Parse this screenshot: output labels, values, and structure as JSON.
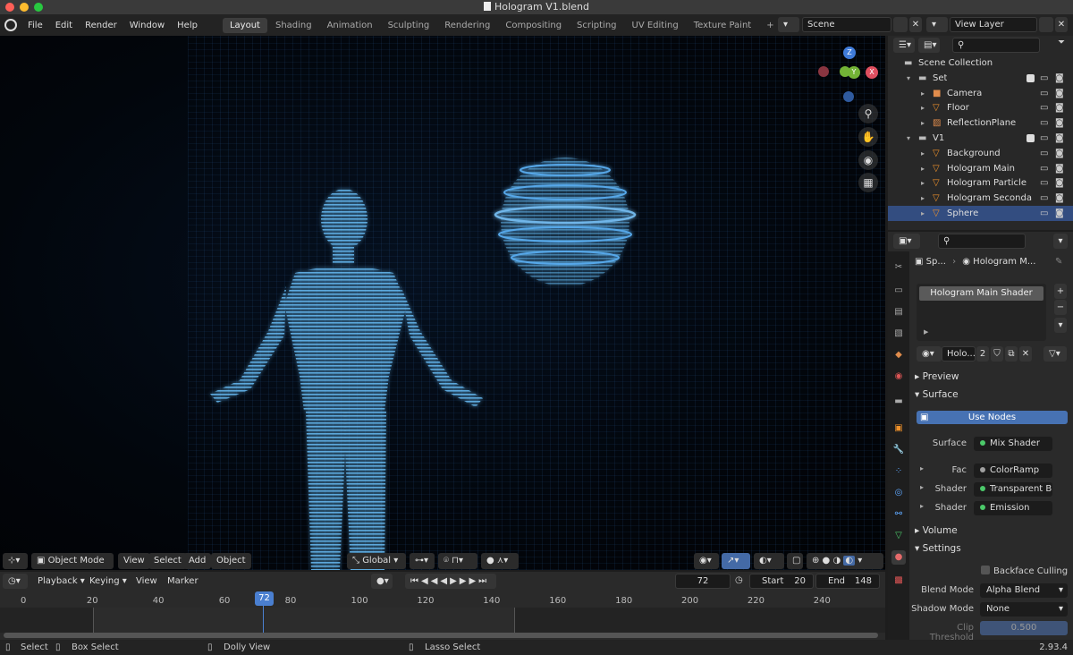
{
  "window": {
    "title": "Hologram V1.blend",
    "version": "2.93.4"
  },
  "menu": [
    "File",
    "Edit",
    "Render",
    "Window",
    "Help"
  ],
  "workspaces": [
    "Layout",
    "Shading",
    "Animation",
    "Sculpting",
    "Rendering",
    "Compositing",
    "Scripting",
    "UV Editing",
    "Texture Paint"
  ],
  "active_workspace": "Layout",
  "scene": {
    "name": "Scene",
    "view_layer": "View Layer"
  },
  "viewport": {
    "mode": "Object Mode",
    "menus": [
      "View",
      "Select",
      "Add",
      "Object"
    ],
    "transform": "Global",
    "gizmo_axes": {
      "z": "Z",
      "y": "Y",
      "x": "X"
    }
  },
  "outliner": {
    "rows": [
      {
        "label": "Scene Collection",
        "indent": 0,
        "icon": "collection-icon"
      },
      {
        "label": "Set",
        "indent": 1,
        "icon": "collection-icon"
      },
      {
        "label": "Camera",
        "indent": 2,
        "icon": "camera-icon"
      },
      {
        "label": "Floor",
        "indent": 2,
        "icon": "mesh-icon"
      },
      {
        "label": "ReflectionPlane",
        "indent": 2,
        "icon": "light-probe-icon"
      },
      {
        "label": "V1",
        "indent": 1,
        "icon": "collection-icon"
      },
      {
        "label": "Background",
        "indent": 2,
        "icon": "mesh-icon"
      },
      {
        "label": "Hologram Main",
        "indent": 2,
        "icon": "mesh-icon"
      },
      {
        "label": "Hologram Particle",
        "indent": 2,
        "icon": "mesh-icon"
      },
      {
        "label": "Hologram Seconda",
        "indent": 2,
        "icon": "mesh-icon"
      },
      {
        "label": "Sphere",
        "indent": 2,
        "icon": "mesh-icon",
        "selected": true
      }
    ]
  },
  "properties": {
    "breadcrumb_object": "Sp...",
    "breadcrumb_material": "Hologram M...",
    "slot": "Hologram Main Shader",
    "material_name": "Holo...",
    "users": "2",
    "sections": {
      "preview": "Preview",
      "surface": "Surface",
      "volume": "Volume",
      "settings": "Settings"
    },
    "use_nodes": "Use Nodes",
    "surface_rows": [
      {
        "label": "Surface",
        "value": "Mix Shader",
        "dot": "green"
      },
      {
        "label": "Fac",
        "value": "ColorRamp",
        "dot": "grey"
      },
      {
        "label": "Shader",
        "value": "Transparent B...",
        "dot": "green"
      },
      {
        "label": "Shader",
        "value": "Emission",
        "dot": "green"
      }
    ],
    "backface_culling": "Backface Culling",
    "blend_mode_label": "Blend Mode",
    "blend_mode": "Alpha Blend",
    "shadow_mode_label": "Shadow Mode",
    "shadow_mode": "None",
    "clip_threshold_label": "Clip Threshold",
    "clip_threshold": "0.500"
  },
  "timeline": {
    "menus": [
      "Playback",
      "Keying",
      "View",
      "Marker"
    ],
    "current_frame": "72",
    "start_label": "Start",
    "start": "20",
    "end_label": "End",
    "end": "148",
    "ticks": [
      "0",
      "20",
      "40",
      "60",
      "80",
      "100",
      "120",
      "140",
      "160",
      "180",
      "200",
      "220",
      "240"
    ]
  },
  "status": {
    "select": "Select",
    "box_select": "Box Select",
    "dolly": "Dolly View",
    "lasso": "Lasso Select"
  }
}
